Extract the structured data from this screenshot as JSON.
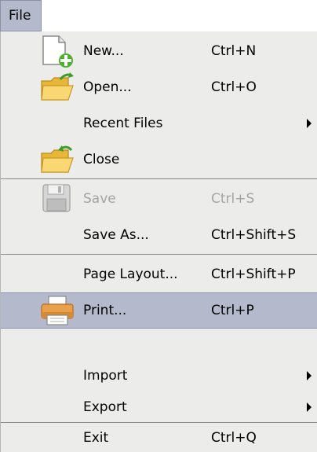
{
  "menubar": {
    "file_label": "File"
  },
  "menu": {
    "new": {
      "label": "New...",
      "shortcut": "Ctrl+N"
    },
    "open": {
      "label": "Open...",
      "shortcut": "Ctrl+O"
    },
    "recent_files": {
      "label": "Recent Files"
    },
    "close": {
      "label": "Close"
    },
    "save": {
      "label": "Save",
      "shortcut": "Ctrl+S"
    },
    "save_as": {
      "label": "Save As...",
      "shortcut": "Ctrl+Shift+S"
    },
    "page_layout": {
      "label": "Page Layout...",
      "shortcut": "Ctrl+Shift+P"
    },
    "print": {
      "label": "Print...",
      "shortcut": "Ctrl+P"
    },
    "import": {
      "label": "Import"
    },
    "export": {
      "label": "Export"
    },
    "exit": {
      "label": "Exit",
      "shortcut": "Ctrl+Q"
    }
  },
  "icons": {
    "new": "new-document-icon",
    "open": "open-folder-icon",
    "close": "close-folder-icon",
    "save": "save-icon",
    "print": "printer-icon"
  },
  "colors": {
    "menu_background": "#ececea",
    "selection_background": "#b4b9cb",
    "disabled_text": "#a4a4a4"
  }
}
